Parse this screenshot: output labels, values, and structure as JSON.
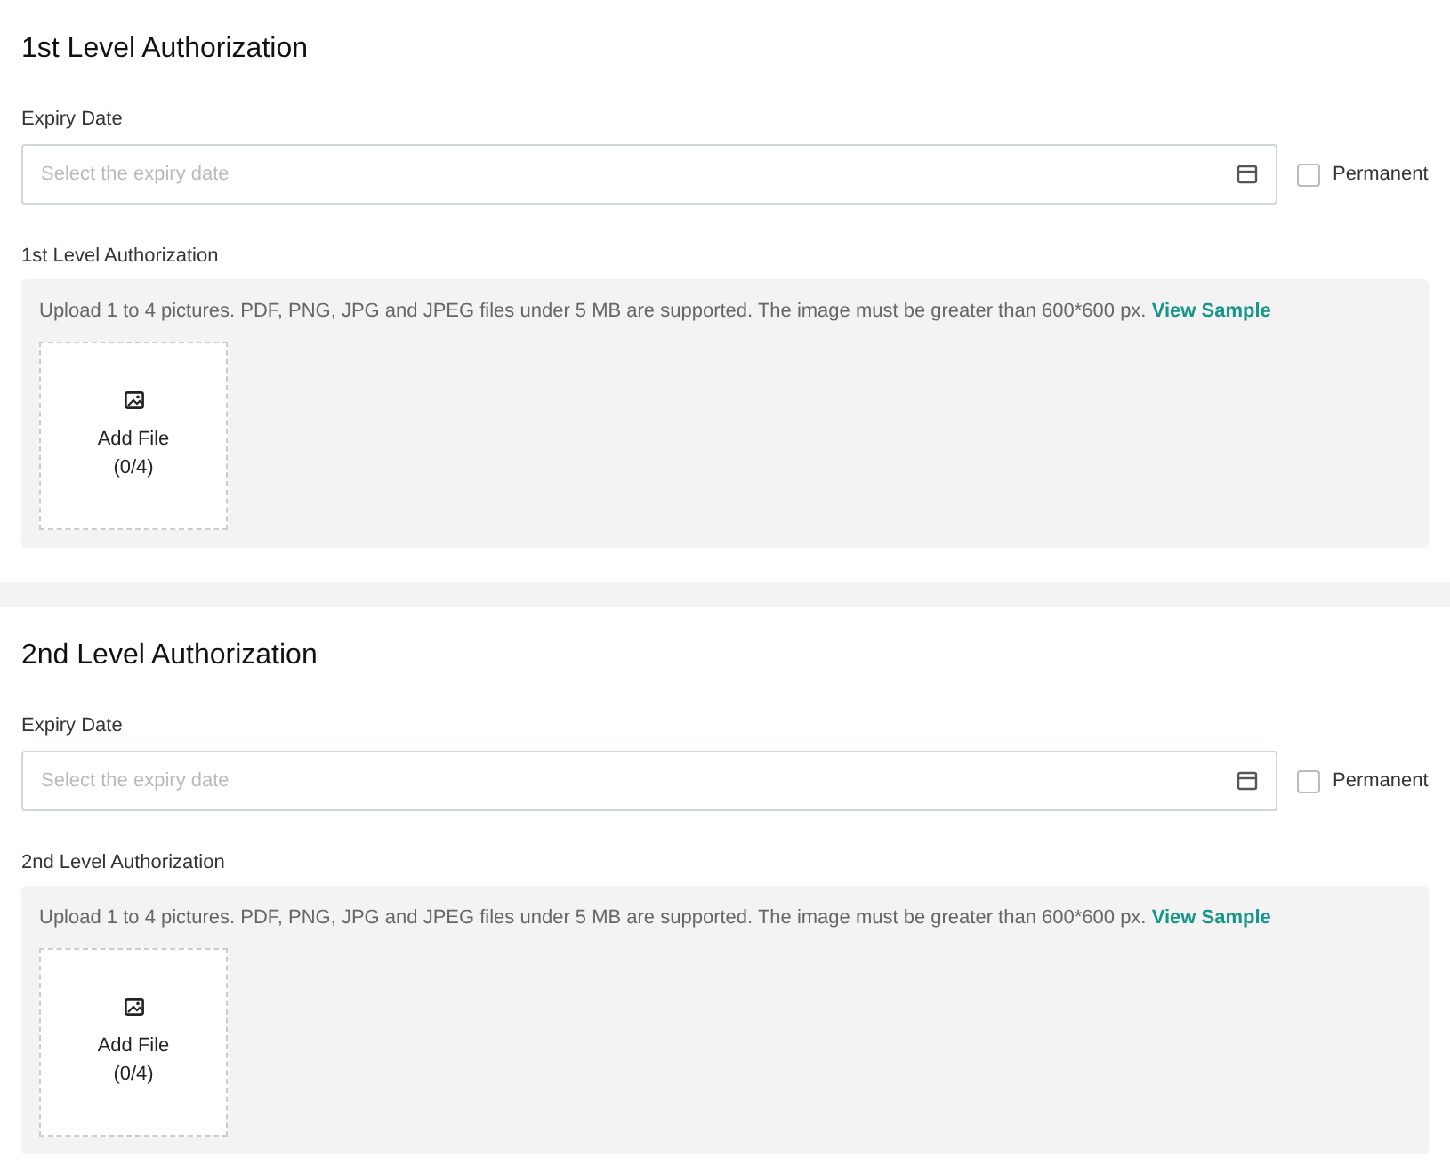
{
  "sections": [
    {
      "title": "1st Level Authorization",
      "expiry_label": "Expiry Date",
      "expiry_placeholder": "Select the expiry date",
      "permanent": {
        "label": "Permanent",
        "checked": false
      },
      "upload_label": "1st Level Authorization",
      "upload_hint": "Upload 1 to 4 pictures. PDF, PNG, JPG and JPEG files under 5 MB are supported. The image must be greater than 600*600 px.",
      "sample_link": "View Sample",
      "add_file": "Add File",
      "count": "(0/4)"
    },
    {
      "title": "2nd Level Authorization",
      "expiry_label": "Expiry Date",
      "expiry_placeholder": "Select the expiry date",
      "permanent": {
        "label": "Permanent",
        "checked": false
      },
      "upload_label": "2nd Level Authorization",
      "upload_hint": "Upload 1 to 4 pictures. PDF, PNG, JPG and JPEG files under 5 MB are supported. The image must be greater than 600*600 px.",
      "sample_link": "View Sample",
      "add_file": "Add File",
      "count": "(0/4)"
    }
  ]
}
